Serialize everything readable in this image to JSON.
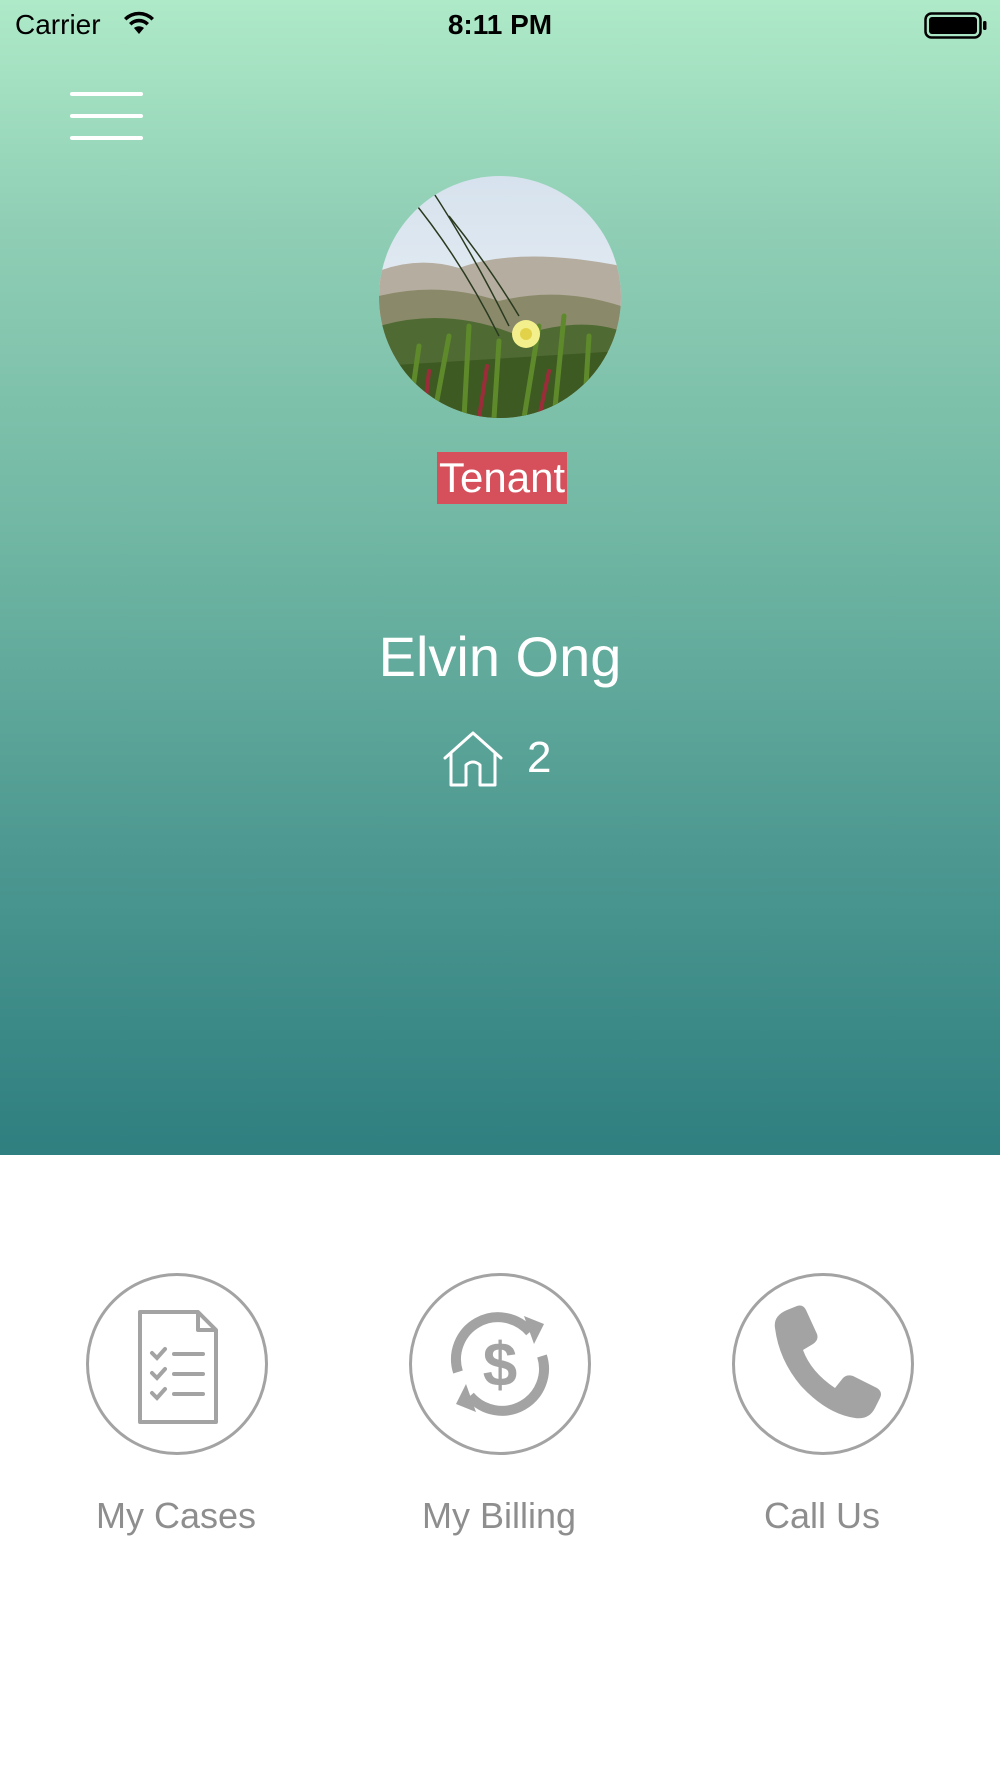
{
  "status_bar": {
    "carrier": "Carrier",
    "time": "8:11 PM"
  },
  "profile": {
    "role": "Tenant",
    "name": "Elvin Ong",
    "property_count": "2"
  },
  "actions": [
    {
      "label": "My Cases",
      "icon": "checklist-document-icon"
    },
    {
      "label": "My Billing",
      "icon": "dollar-cycle-icon"
    },
    {
      "label": "Call Us",
      "icon": "phone-icon"
    }
  ],
  "colors": {
    "hero_top": "#aeeac8",
    "hero_bottom": "#2f7f80",
    "role_badge": "#d5505b",
    "icon_gray": "#a3a3a3"
  }
}
